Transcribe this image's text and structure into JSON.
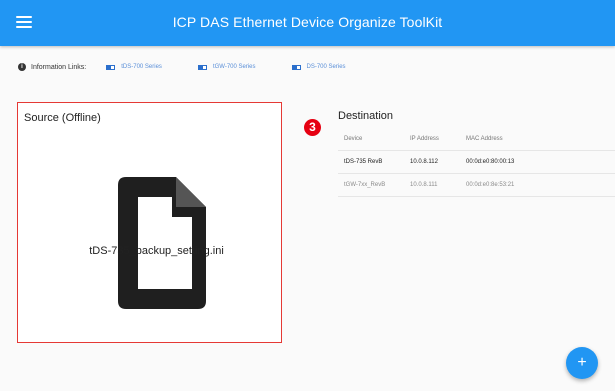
{
  "app": {
    "title": "ICP DAS Ethernet Device Organize ToolKit"
  },
  "info_links": {
    "label": "Information Links:",
    "links": [
      {
        "label": "tDS-700 Series"
      },
      {
        "label": "tGW-700 Series"
      },
      {
        "label": "DS-700 Series"
      }
    ]
  },
  "source": {
    "title": "Source (Offline)",
    "file_name": "tDS-735_backup_setting.ini",
    "icon": "file-icon"
  },
  "step_badge": "3",
  "destination": {
    "title": "Destination",
    "columns": [
      "Device",
      "IP Address",
      "MAC Address"
    ],
    "rows": [
      {
        "device": "tDS-735 RevB",
        "ip": "10.0.8.112",
        "mac": "00:0d:e0:80:00:13"
      },
      {
        "device": "tGW-7xx_RevB",
        "ip": "10.0.8.111",
        "mac": "00:0d:e0:8e:53:21"
      }
    ]
  },
  "fab": {
    "label": "+"
  },
  "colors": {
    "appbar": "#2196f3",
    "source_border": "#e53935",
    "badge": "#e60012"
  }
}
